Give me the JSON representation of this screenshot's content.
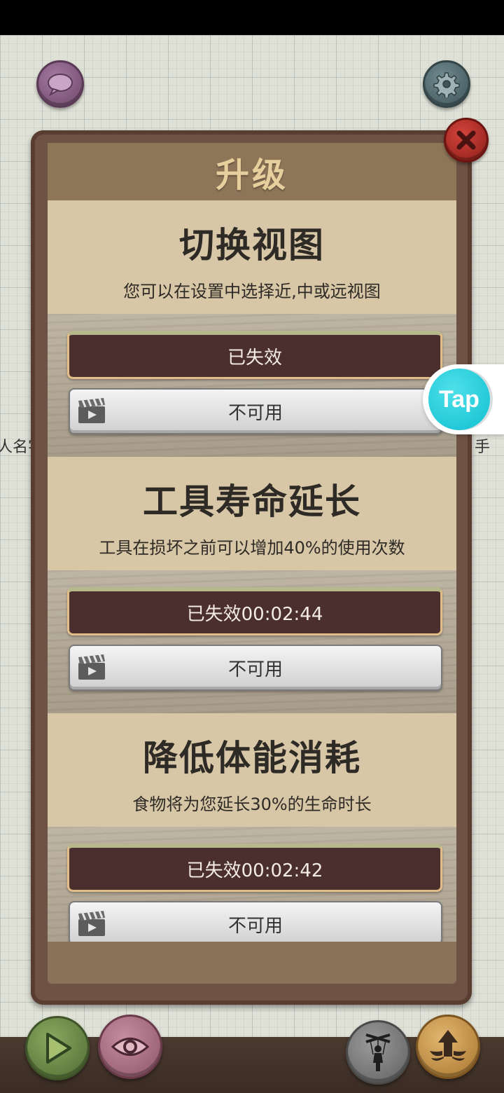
{
  "panel": {
    "title": "升级"
  },
  "upgrades": [
    {
      "title": "切换视图",
      "description": "您可以在设置中选择近,中或远视图",
      "status": "已失效",
      "video_label": "不可用"
    },
    {
      "title": "工具寿命延长",
      "description": "工具在损坏之前可以增加40%的使用次数",
      "status": "已失效00:02:44",
      "video_label": "不可用"
    },
    {
      "title": "降低体能消耗",
      "description": "食物将为您延长30%的生命时长",
      "status": "已失效00:02:42",
      "video_label": "不可用"
    }
  ],
  "background_text": {
    "left": "人名字",
    "right": "手"
  },
  "tap_badge": {
    "label": "Tap"
  },
  "icons": {
    "chat": "chat-bubble-icon",
    "settings": "gear-icon",
    "close": "close-x-icon",
    "video": "clapperboard-icon",
    "play": "play-icon",
    "eye": "eye-icon",
    "puppet": "puppet-icon",
    "upgrade": "winged-arrow-icon"
  },
  "colors": {
    "status_button": "#4b2f2f",
    "panel_frame": "#6e5244",
    "card_top": "#d8c7a6"
  }
}
